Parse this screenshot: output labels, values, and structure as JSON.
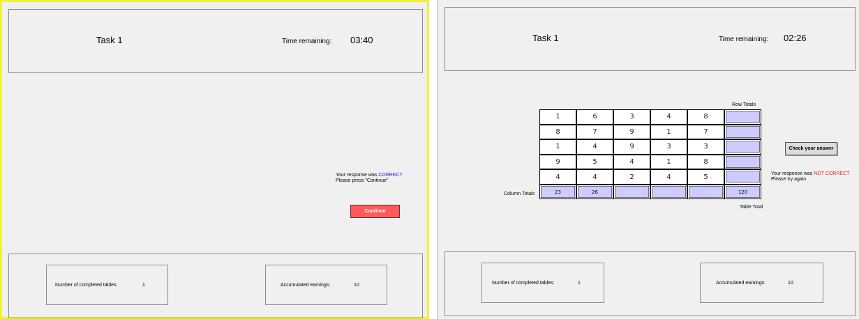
{
  "left_screen": {
    "task_title": "Task 1",
    "time_label": "Time remaining:",
    "time_value": "03:40",
    "response_prefix": "Your response was ",
    "response_status": "CORRECT",
    "instruction": "Please press \"Continue\"",
    "continue_label": "Continue",
    "completed_label": "Number of completed tables:",
    "completed_value": "1",
    "earnings_label": "Accumulated earnings:",
    "earnings_value": "10",
    "border_color": "#f5ef3a",
    "status_color": "#1d1dd8",
    "button_color": "#ff5a5a"
  },
  "right_screen": {
    "task_title": "Task 1",
    "time_label": "Time remaining:",
    "time_value": "02:26",
    "row_totals_label": "Row Totals",
    "column_totals_label": "Column Totals",
    "table_total_label": "Table Total",
    "grid": [
      [
        "1",
        "6",
        "3",
        "4",
        "8"
      ],
      [
        "8",
        "7",
        "9",
        "1",
        "7"
      ],
      [
        "1",
        "4",
        "9",
        "3",
        "3"
      ],
      [
        "9",
        "5",
        "4",
        "1",
        "8"
      ],
      [
        "4",
        "4",
        "2",
        "4",
        "5"
      ]
    ],
    "row_totals": [
      "",
      "",
      "",
      "",
      ""
    ],
    "column_totals": [
      "23",
      "26",
      "",
      "",
      ""
    ],
    "table_total": "120",
    "check_label": "Check your answer",
    "response_prefix": "Your response was ",
    "response_status": "NOT CORRECT",
    "instruction": "Please try again",
    "completed_label": "Number of completed tables:",
    "completed_value": "1",
    "earnings_label": "Accumulated earnings:",
    "earnings_value": "10",
    "status_color": "#ff1e1e",
    "input_color": "#ccccff"
  }
}
